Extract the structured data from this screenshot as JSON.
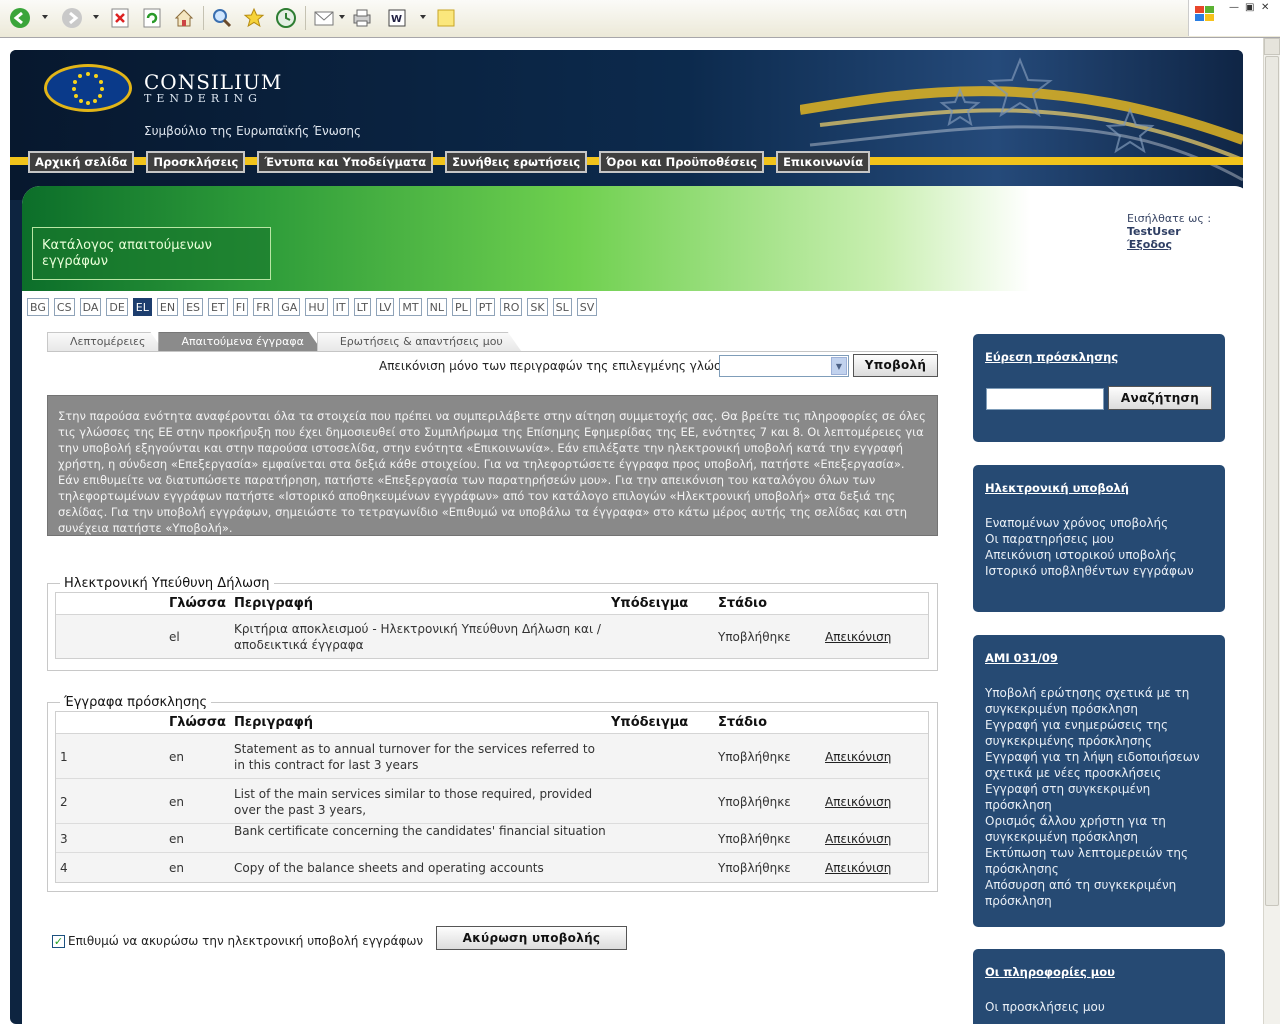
{
  "site": {
    "logo_title": "CONSILIUM",
    "logo_subtitle": "TENDERING",
    "council": "Συμβούλιο της Ευρωπαϊκής Ένωσης"
  },
  "nav": [
    "Αρχική σελίδα",
    "Προσκλήσεις",
    "Έντυπα και Υποδείγματα",
    "Συνήθεις ερωτήσεις",
    "Όροι και Προϋποθέσεις",
    "Επικοινωνία"
  ],
  "page_title": "Κατάλογος απαιτούμενων εγγράφων",
  "user": {
    "logged_label": "Εισήλθατε ως :",
    "name": "TestUser",
    "logout": "Έξοδος"
  },
  "languages": [
    "BG",
    "CS",
    "DA",
    "DE",
    "EL",
    "EN",
    "ES",
    "ET",
    "FI",
    "FR",
    "GA",
    "HU",
    "IT",
    "LT",
    "LV",
    "MT",
    "NL",
    "PL",
    "PT",
    "RO",
    "SK",
    "SL",
    "SV"
  ],
  "selected_language": "EL",
  "tabs": [
    "Λεπτομέρειες",
    "Απαιτούμενα έγγραφα",
    "Ερωτήσεις & απαντήσεις μου"
  ],
  "active_tab": 1,
  "filter": {
    "label": "Απεικόνιση μόνο των περιγραφών της επιλεγμένης γλώσσας",
    "value": "",
    "submit": "Υποβολή"
  },
  "info_text": "Στην παρούσα ενότητα αναφέρονται όλα τα στοιχεία που πρέπει να συμπεριλάβετε στην αίτηση συμμετοχής σας. Θα βρείτε τις πληροφορίες σε όλες τις γλώσσες της ΕΕ στην προκήρυξη που έχει δημοσιευθεί στο Συμπλήρωμα της Επίσημης Εφημερίδας της ΕΕ, ενότητες 7 και 8. Οι λεπτομέρειες για την υποβολή εξηγούνται και στην παρούσα ιστοσελίδα, στην ενότητα «Επικοινωνία». Εάν επιλέξατε την ηλεκτρονική υποβολή κατά την εγγραφή χρήστη, η σύνδεση «Επεξεργασία» εμφαίνεται στα δεξιά κάθε στοιχείου. Για να τηλεφορτώσετε έγγραφα προς υποβολή, πατήστε «Επεξεργασία». Εάν επιθυμείτε να διατυπώσετε παρατήρηση, πατήστε «Επεξεργασία των παρατηρήσεών μου». Για την απεικόνιση του καταλόγου όλων των τηλεφορτωμένων εγγράφων πατήστε «Ιστορικό αποθηκευμένων εγγράφων» από τον κατάλογο επιλογών «Ηλεκτρονική υποβολή» στα δεξιά της σελίδας. Για την υποβολή εγγράφων, σημειώστε το τετραγωνίδιο «Επιθυμώ να υποβάλω τα έγγραφα» στο κάτω μέρος αυτής της σελίδας και στη συνέχεια πατήστε «Υποβολή».",
  "columns": {
    "language": "Γλώσσα",
    "description": "Περιγραφή",
    "template": "Υπόδειγμα",
    "stage": "Στάδιο"
  },
  "section1": {
    "title": "Ηλεκτρονική Υπεύθυνη Δήλωση",
    "rows": [
      {
        "num": "",
        "lang": "el",
        "desc": "Κριτήρια αποκλεισμού - Ηλεκτρονική Υπεύθυνη Δήλωση και / αποδεικτικά έγγραφα",
        "stage": "Υποβλήθηκε",
        "action": "Απεικόνιση"
      }
    ]
  },
  "section2": {
    "title": "Έγγραφα πρόσκλησης",
    "rows": [
      {
        "num": "1",
        "lang": "en",
        "desc": "Statement as to annual turnover for the services referred to in this contract for last 3 years",
        "stage": "Υποβλήθηκε",
        "action": "Απεικόνιση"
      },
      {
        "num": "2",
        "lang": "en",
        "desc": "List of the main services similar to those required, provided over the past 3 years,",
        "stage": "Υποβλήθηκε",
        "action": "Απεικόνιση"
      },
      {
        "num": "3",
        "lang": "en",
        "desc": "Bank certificate concerning the candidates' financial situation",
        "stage": "Υποβλήθηκε",
        "action": "Απεικόνιση"
      },
      {
        "num": "4",
        "lang": "en",
        "desc": "Copy of the balance sheets and operating accounts",
        "stage": "Υποβλήθηκε",
        "action": "Απεικόνιση"
      }
    ]
  },
  "cancel": {
    "checkbox_label": "Επιθυμώ να ακυρώσω την ηλεκτρονική υποβολή εγγράφων",
    "checked": true,
    "button": "Ακύρωση υποβολής"
  },
  "sidebar": {
    "search": {
      "title": "Εύρεση πρόσκλησης",
      "button": "Αναζήτηση",
      "value": ""
    },
    "esub": {
      "title": "Ηλεκτρονική υποβολή",
      "links": [
        "Εναπομένων χρόνος υποβολής",
        "Οι παρατηρήσεις μου",
        "Απεικόνιση ιστορικού υποβολής",
        "Ιστορικό υποβληθέντων εγγράφων"
      ]
    },
    "ami": {
      "title": "AMI 031/09",
      "links": [
        "Υποβολή ερώτησης σχετικά με τη συγκεκριμένη πρόσκληση",
        "Εγγραφή για ενημερώσεις της συγκεκριμένης πρόσκλησης",
        "Εγγραφή για τη λήψη ειδοποιήσεων σχετικά με νέες προσκλήσεις",
        "Εγγραφή στη συγκεκριμένη πρόσκληση",
        "Ορισμός άλλου χρήστη για τη συγκεκριμένη πρόσκληση",
        "Εκτύπωση των λεπτομερειών της πρόσκλησης",
        "Απόσυρση από τη συγκεκριμένη πρόσκληση"
      ]
    },
    "myinfo": {
      "title": "Οι πληροφορίες μου",
      "links": [
        "Οι προσκλήσεις μου"
      ]
    }
  },
  "colors": {
    "navy": "#0d2440",
    "gold": "#f1c31b",
    "side_panel": "#264a73",
    "info_bg": "#898989"
  }
}
